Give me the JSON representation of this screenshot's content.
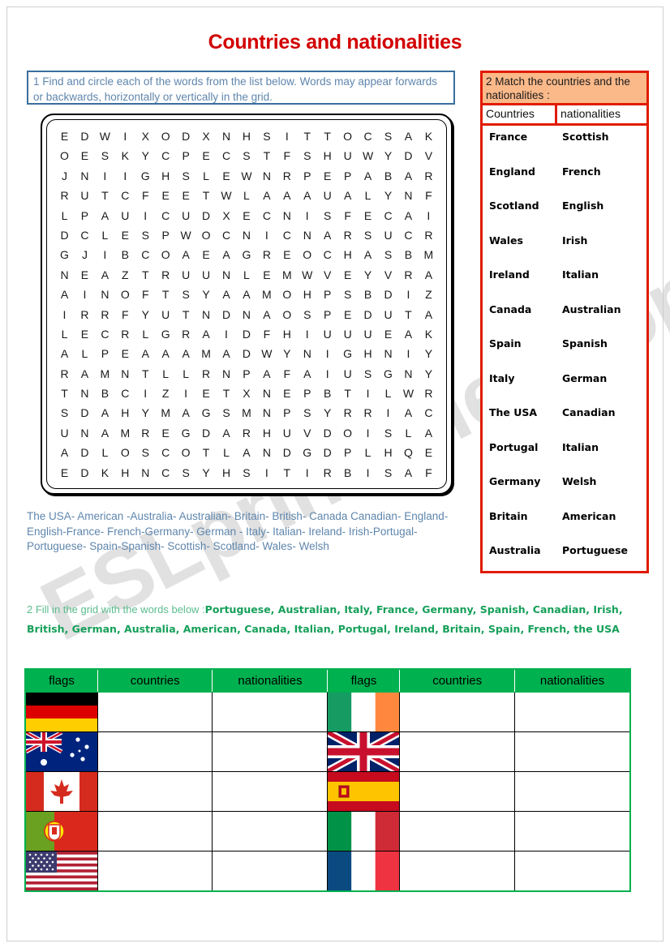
{
  "watermark": "ESLprintables.com",
  "title": "Countries and nationalities",
  "exercise1": {
    "instruction": "1 Find and circle each of the words from the list below. Words may appear forwards or backwards, horizontally or vertically in the grid.",
    "grid": [
      [
        "E",
        "D",
        "W",
        "I",
        "X",
        "O",
        "D",
        "X",
        "N",
        "H",
        "S",
        "I",
        "T",
        "T",
        "O",
        "C",
        "S",
        "A",
        "K"
      ],
      [
        "O",
        "E",
        "S",
        "K",
        "Y",
        "C",
        "P",
        "E",
        "C",
        "S",
        "T",
        "F",
        "S",
        "H",
        "U",
        "W",
        "Y",
        "D",
        "V"
      ],
      [
        "J",
        "N",
        "I",
        "I",
        "G",
        "H",
        "S",
        "L",
        "E",
        "W",
        "N",
        "R",
        "P",
        "E",
        "P",
        "A",
        "B",
        "A",
        "R"
      ],
      [
        "R",
        "U",
        "T",
        "C",
        "F",
        "E",
        "E",
        "T",
        "W",
        "L",
        "A",
        "A",
        "A",
        "U",
        "A",
        "L",
        "Y",
        "N",
        "F"
      ],
      [
        "L",
        "P",
        "A",
        "U",
        "I",
        "C",
        "U",
        "D",
        "X",
        "E",
        "C",
        "N",
        "I",
        "S",
        "F",
        "E",
        "C",
        "A",
        "I"
      ],
      [
        "D",
        "C",
        "L",
        "E",
        "S",
        "P",
        "W",
        "O",
        "C",
        "N",
        "I",
        "C",
        "N",
        "A",
        "R",
        "S",
        "U",
        "C",
        "R"
      ],
      [
        "G",
        "J",
        "I",
        "B",
        "C",
        "O",
        "A",
        "E",
        "A",
        "G",
        "R",
        "E",
        "O",
        "C",
        "H",
        "A",
        "S",
        "B",
        "M"
      ],
      [
        "N",
        "E",
        "A",
        "Z",
        "T",
        "R",
        "U",
        "U",
        "N",
        "L",
        "E",
        "M",
        "W",
        "V",
        "E",
        "Y",
        "V",
        "R",
        "A"
      ],
      [
        "A",
        "I",
        "N",
        "O",
        "F",
        "T",
        "S",
        "Y",
        "A",
        "A",
        "M",
        "O",
        "H",
        "P",
        "S",
        "B",
        "D",
        "I",
        "Z"
      ],
      [
        "I",
        "R",
        "R",
        "F",
        "Y",
        "U",
        "T",
        "N",
        "D",
        "N",
        "A",
        "O",
        "S",
        "P",
        "E",
        "D",
        "U",
        "T",
        "A"
      ],
      [
        "L",
        "E",
        "C",
        "R",
        "L",
        "G",
        "R",
        "A",
        "I",
        "D",
        "F",
        "H",
        "I",
        "U",
        "U",
        "U",
        "E",
        "A",
        "K"
      ],
      [
        "A",
        "L",
        "P",
        "E",
        "A",
        "A",
        "A",
        "M",
        "A",
        "D",
        "W",
        "Y",
        "N",
        "I",
        "G",
        "H",
        "N",
        "I",
        "Y"
      ],
      [
        "R",
        "A",
        "M",
        "N",
        "T",
        "L",
        "L",
        "R",
        "N",
        "P",
        "A",
        "F",
        "A",
        "I",
        "U",
        "S",
        "G",
        "N",
        "Y"
      ],
      [
        "T",
        "N",
        "B",
        "C",
        "I",
        "Z",
        "I",
        "E",
        "T",
        "X",
        "N",
        "E",
        "P",
        "B",
        "T",
        "I",
        "L",
        "W",
        "R"
      ],
      [
        "S",
        "D",
        "A",
        "H",
        "Y",
        "M",
        "A",
        "G",
        "S",
        "M",
        "N",
        "P",
        "S",
        "Y",
        "R",
        "R",
        "I",
        "A",
        "C"
      ],
      [
        "U",
        "N",
        "A",
        "M",
        "R",
        "E",
        "G",
        "D",
        "A",
        "R",
        "H",
        "U",
        "V",
        "D",
        "O",
        "I",
        "S",
        "L",
        "A"
      ],
      [
        "A",
        "D",
        "L",
        "O",
        "S",
        "C",
        "O",
        "T",
        "L",
        "A",
        "N",
        "D",
        "G",
        "D",
        "P",
        "L",
        "H",
        "Q",
        "E"
      ],
      [
        "E",
        "D",
        "K",
        "H",
        "N",
        "C",
        "S",
        "Y",
        "H",
        "S",
        "I",
        "T",
        "I",
        "R",
        "B",
        "I",
        "S",
        "A",
        "F"
      ]
    ],
    "wordlist": "The USA- American -Australia- Australian- Britain- British- Canada Canadian- England- English-France- French-Germany- German - Italy- Italian- Ireland- Irish-Portugal-Portuguese- Spain-Spanish- Scottish- Scotland- Wales- Welsh"
  },
  "exercise2_match": {
    "instruction": "2 Match the countries and the nationalities :",
    "col_countries": "Countries",
    "col_nationalities": "nationalities",
    "countries": [
      "France",
      "England",
      "Scotland",
      "Wales",
      "Ireland",
      "Canada",
      "Spain",
      "Italy",
      "The USA",
      "Portugal",
      "Germany",
      "Britain",
      "Australia"
    ],
    "nationalities": [
      "Scottish",
      "French",
      "English",
      "Irish",
      "Italian",
      "Australian",
      "Spanish",
      "German",
      "Canadian",
      "Italian",
      "Welsh",
      "American",
      "Portuguese"
    ]
  },
  "exercise2_fill": {
    "lead": "2 Fill in the grid with the words below :",
    "words": "Portuguese,  Australian,  Italy,  France,  Germany,  Spanish,  Canadian,  Irish,  British,  German,  Australia,  American,  Canada,  Italian,  Portugal,  Ireland,  Britain,  Spain,  French,  the USA"
  },
  "flags_table": {
    "headers": [
      "flags",
      "countries",
      "nationalities",
      "flags",
      "countries",
      "nationalities"
    ],
    "left_flags": [
      "germany-flag",
      "australia-flag",
      "canada-flag",
      "portugal-flag",
      "usa-flag"
    ],
    "right_flags": [
      "ireland-flag",
      "united-kingdom-flag",
      "spain-flag",
      "italy-flag",
      "france-flag"
    ]
  },
  "colors": {
    "title_red": "#d20000",
    "instruction_blue": "#5f86ad",
    "panel_red": "#e01b00",
    "panel_peach": "#fbb98a",
    "green": "#00b14f",
    "green_text": "#16a05a"
  }
}
